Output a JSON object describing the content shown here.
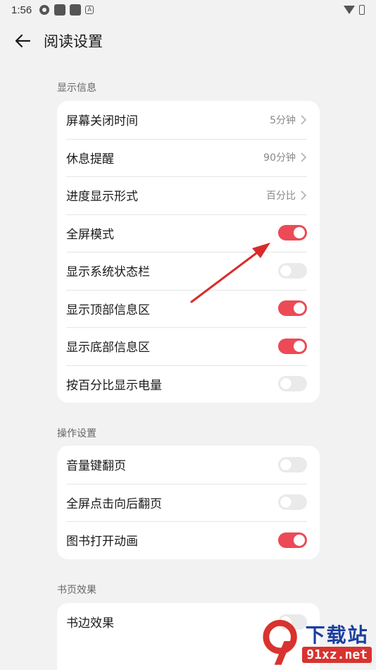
{
  "status_bar": {
    "time": "1:56",
    "a_badge": "A"
  },
  "header": {
    "title": "阅读设置"
  },
  "sections": [
    {
      "label": "显示信息",
      "rows": [
        {
          "label": "屏幕关闭时间",
          "kind": "value",
          "value": "5分钟"
        },
        {
          "label": "休息提醒",
          "kind": "value",
          "value": "90分钟"
        },
        {
          "label": "进度显示形式",
          "kind": "value",
          "value": "百分比"
        },
        {
          "label": "全屏模式",
          "kind": "toggle",
          "on": true
        },
        {
          "label": "显示系统状态栏",
          "kind": "toggle",
          "on": false
        },
        {
          "label": "显示顶部信息区",
          "kind": "toggle",
          "on": true
        },
        {
          "label": "显示底部信息区",
          "kind": "toggle",
          "on": true
        },
        {
          "label": "按百分比显示电量",
          "kind": "toggle",
          "on": false
        }
      ]
    },
    {
      "label": "操作设置",
      "rows": [
        {
          "label": "音量键翻页",
          "kind": "toggle",
          "on": false
        },
        {
          "label": "全屏点击向后翻页",
          "kind": "toggle",
          "on": false
        },
        {
          "label": "图书打开动画",
          "kind": "toggle",
          "on": true
        }
      ]
    },
    {
      "label": "书页效果",
      "rows": [
        {
          "label": "书边效果",
          "kind": "toggle",
          "on": false
        }
      ]
    }
  ],
  "watermark": {
    "main": "下载站",
    "sub": "91xz.net"
  },
  "colors": {
    "accent": "#ec4a56",
    "annotation": "#d92b2b",
    "background": "#f2f2f2"
  }
}
